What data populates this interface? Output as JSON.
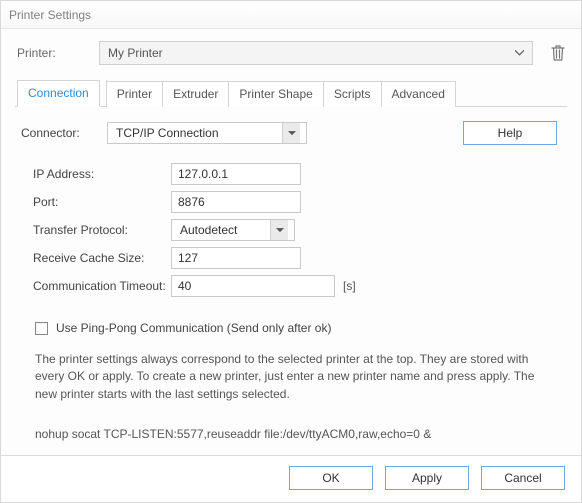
{
  "window": {
    "title": "Printer Settings"
  },
  "printer_row": {
    "label": "Printer:",
    "selected": "My Printer"
  },
  "tabs": {
    "t0": "Connection",
    "t1": "Printer",
    "t2": "Extruder",
    "t3": "Printer Shape",
    "t4": "Scripts",
    "t5": "Advanced"
  },
  "connector": {
    "label": "Connector:",
    "value": "TCP/IP Connection",
    "help": "Help"
  },
  "fields": {
    "ip_label": "IP Address:",
    "ip_value": "127.0.0.1",
    "port_label": "Port:",
    "port_value": "8876",
    "proto_label": "Transfer Protocol:",
    "proto_value": "Autodetect",
    "cache_label": "Receive Cache Size:",
    "cache_value": "127",
    "timeout_label": "Communication Timeout:",
    "timeout_value": "40",
    "timeout_unit": "[s]"
  },
  "pingpong": {
    "label": "Use Ping-Pong Communication (Send only after ok)"
  },
  "description": "The printer settings always correspond to the selected printer at the top. They are stored with every OK or apply. To create a new printer, just enter a new printer name and press apply. The new printer starts with the last settings selected.",
  "command": "nohup socat TCP-LISTEN:5577,reuseaddr file:/dev/ttyACM0,raw,echo=0 &",
  "footer": {
    "ok": "OK",
    "apply": "Apply",
    "cancel": "Cancel"
  }
}
